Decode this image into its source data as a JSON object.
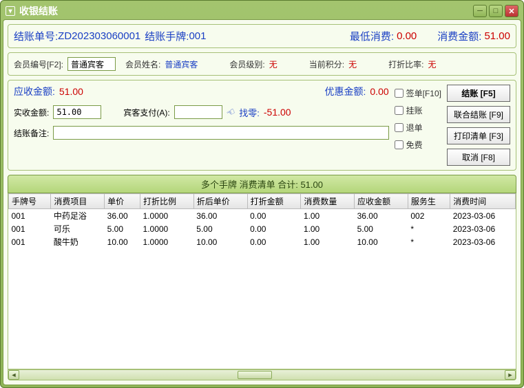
{
  "window_title": "收银结账",
  "header": {
    "bill_no_label": "结账单号:",
    "bill_no": "ZD202303060001",
    "hand_label": "结账手牌:",
    "hand": "001",
    "min_label": "最低消费:",
    "min_val": "0.00",
    "amount_label": "消费金额:",
    "amount_val": "51.00"
  },
  "member": {
    "no_label": "会员编号[F2]:",
    "no_val": "普通宾客",
    "name_label": "会员姓名:",
    "name_val": "普通宾客",
    "level_label": "会员级别:",
    "level_val": "无",
    "points_label": "当前积分:",
    "points_val": "无",
    "discount_label": "打折比率:",
    "discount_val": "无"
  },
  "pay": {
    "receivable_label": "应收金额:",
    "receivable_val": "51.00",
    "coupon_label": "优惠金额:",
    "coupon_val": "0.00",
    "actual_label": "实收金额:",
    "actual_val": "51.00",
    "guest_label": "宾客支付(A):",
    "guest_val": "",
    "change_label": "找零:",
    "change_val": "-51.00",
    "remark_label": "结账备注:",
    "remark_val": ""
  },
  "checks": {
    "sign": "签单[F10]",
    "credit": "挂账",
    "refund": "退单",
    "free": "免费"
  },
  "buttons": {
    "checkout": "结账 [F5]",
    "union": "联合结账 [F9]",
    "print": "打印清单 [F3]",
    "cancel": "取消 [F8]"
  },
  "list_header": "多个手牌  消费清单  合计: 51.00",
  "columns": [
    "手牌号",
    "消费项目",
    "单价",
    "打折比例",
    "折后单价",
    "打折金额",
    "消费数量",
    "应收金额",
    "服务生",
    "消费时间"
  ],
  "rows": [
    {
      "c": [
        "001",
        "中药足浴",
        "36.00",
        "1.0000",
        "36.00",
        "0.00",
        "1.00",
        "36.00",
        "002",
        "2023-03-06"
      ]
    },
    {
      "c": [
        "001",
        "可乐",
        "5.00",
        "1.0000",
        "5.00",
        "0.00",
        "1.00",
        "5.00",
        "*",
        "2023-03-06"
      ]
    },
    {
      "c": [
        "001",
        "酸牛奶",
        "10.00",
        "1.0000",
        "10.00",
        "0.00",
        "1.00",
        "10.00",
        "*",
        "2023-03-06"
      ]
    }
  ]
}
